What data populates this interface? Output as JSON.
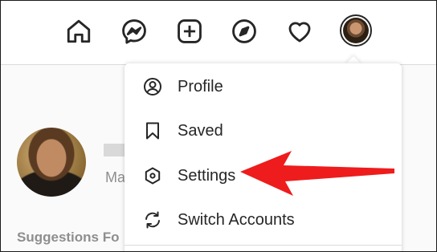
{
  "nav": {
    "icons": [
      "home-icon",
      "messenger-icon",
      "new-post-icon",
      "explore-icon",
      "activity-heart-icon",
      "profile-avatar"
    ]
  },
  "profile": {
    "name_partial": "Ma"
  },
  "suggestions": {
    "heading_partial": "Suggestions Fo"
  },
  "menu": {
    "items": [
      {
        "label": "Profile",
        "icon": "profile-icon"
      },
      {
        "label": "Saved",
        "icon": "bookmark-icon"
      },
      {
        "label": "Settings",
        "icon": "settings-gear-icon"
      },
      {
        "label": "Switch Accounts",
        "icon": "switch-accounts-icon"
      }
    ]
  },
  "colors": {
    "annotation_arrow": "#ee1c1c",
    "text": "#262626",
    "muted": "#8e8e8e",
    "border": "#dbdbdb"
  }
}
